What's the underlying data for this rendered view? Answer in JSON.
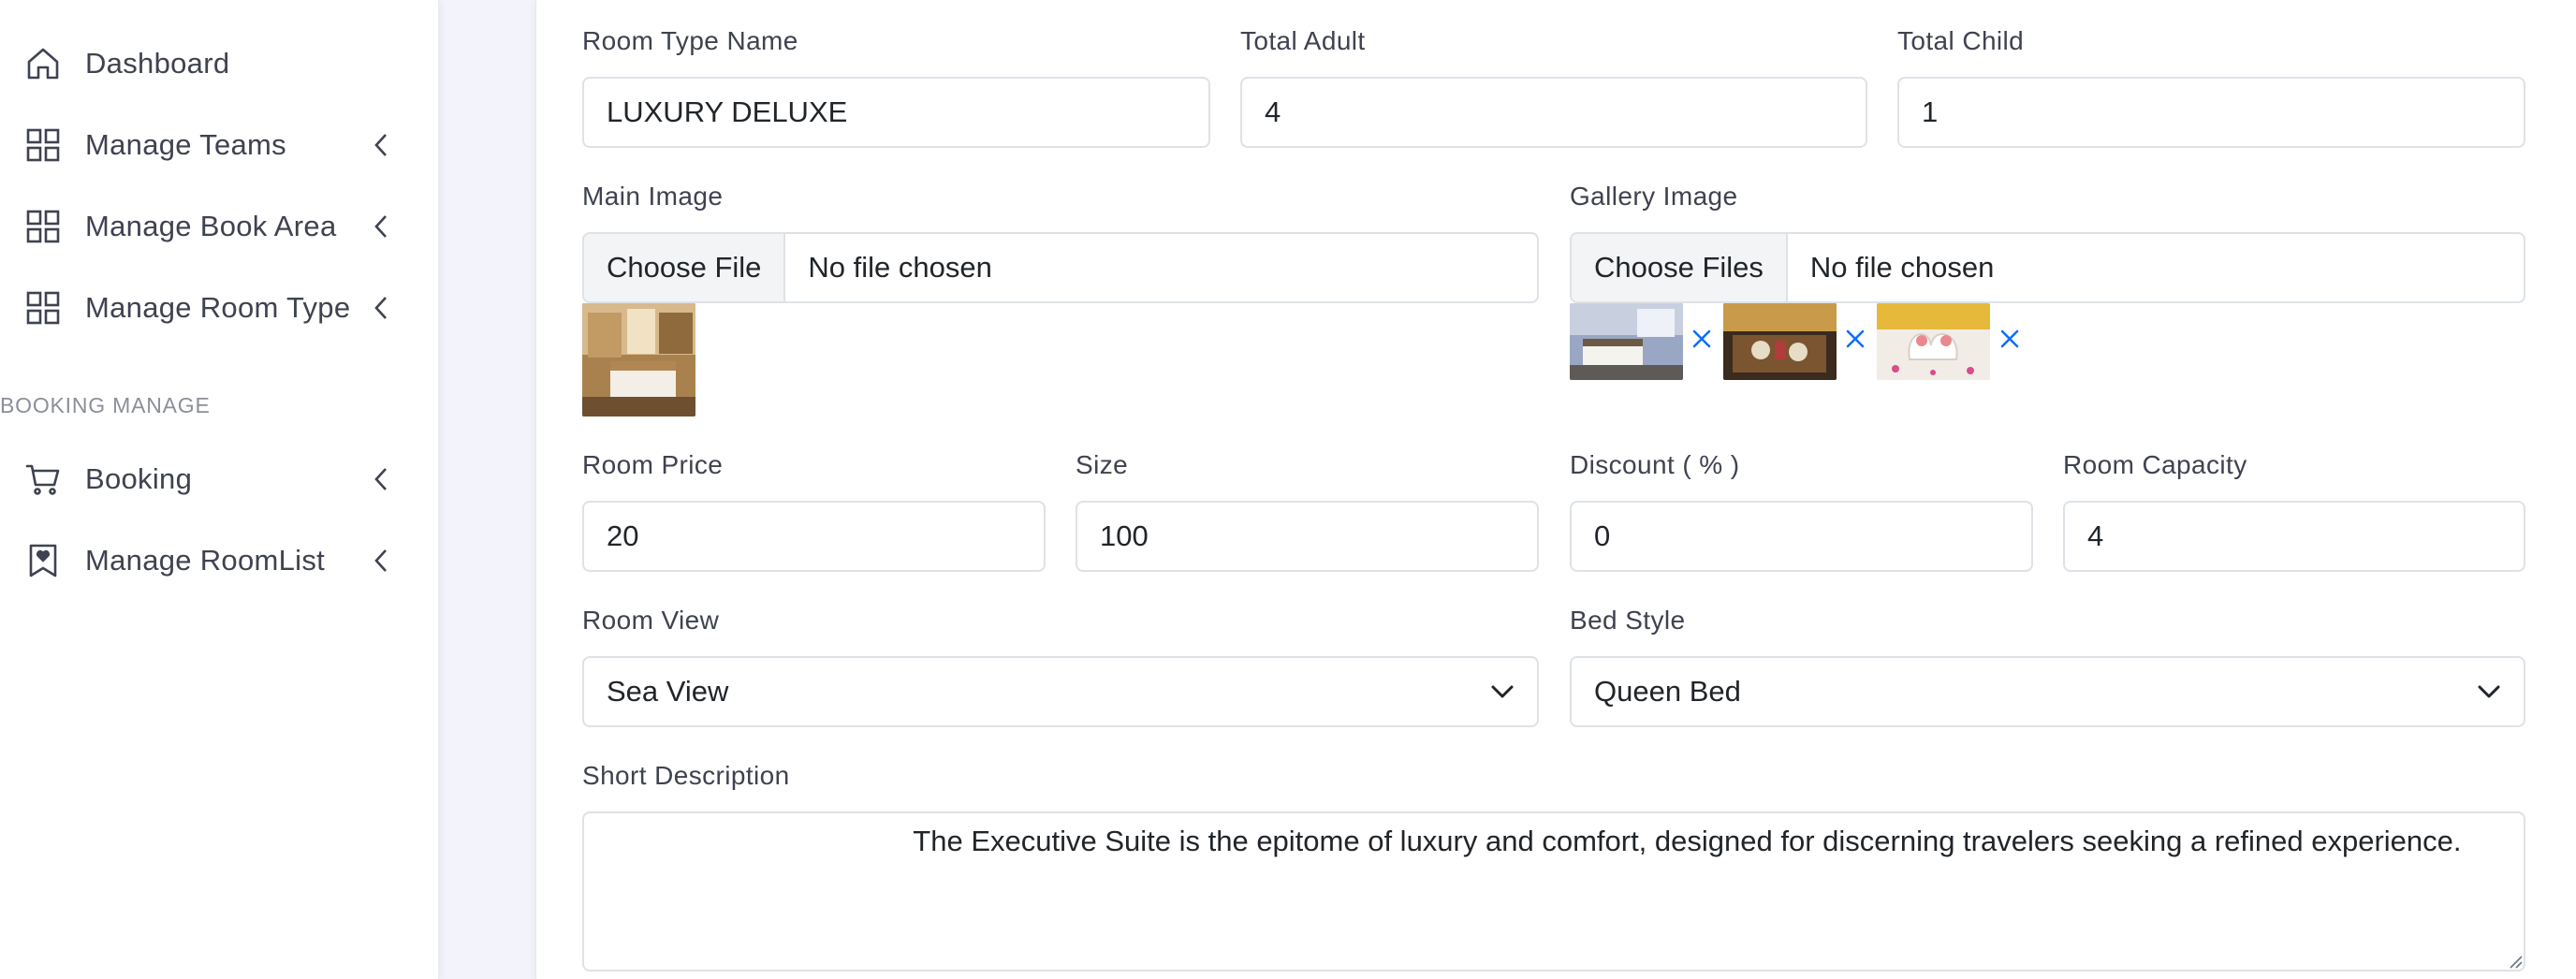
{
  "sidebar": {
    "items": [
      {
        "label": "Dashboard",
        "icon": "home-icon",
        "chevron": false
      },
      {
        "label": "Manage Teams",
        "icon": "grid-icon",
        "chevron": true
      },
      {
        "label": "Manage Book Area",
        "icon": "grid-icon",
        "chevron": true
      },
      {
        "label": "Manage Room Type",
        "icon": "grid-icon",
        "chevron": true
      },
      {
        "label": "Booking",
        "icon": "cart-icon",
        "chevron": true
      },
      {
        "label": "Manage RoomList",
        "icon": "bookmark-heart-icon",
        "chevron": true
      }
    ],
    "section_label": "BOOKING MANAGE"
  },
  "form": {
    "room_type_name": {
      "label": "Room Type Name",
      "value": "LUXURY DELUXE"
    },
    "total_adult": {
      "label": "Total Adult",
      "value": "4"
    },
    "total_child": {
      "label": "Total Child",
      "value": "1"
    },
    "main_image": {
      "label": "Main Image",
      "button": "Choose File",
      "status": "No file chosen"
    },
    "gallery_image": {
      "label": "Gallery Image",
      "button": "Choose Files",
      "status": "No file chosen"
    },
    "room_price": {
      "label": "Room Price",
      "value": "20"
    },
    "size": {
      "label": "Size",
      "value": "100"
    },
    "discount": {
      "label": "Discount ( % )",
      "value": "0"
    },
    "room_capacity": {
      "label": "Room Capacity",
      "value": "4"
    },
    "room_view": {
      "label": "Room View",
      "selected": "Sea View"
    },
    "bed_style": {
      "label": "Bed Style",
      "selected": "Queen Bed"
    },
    "short_description": {
      "label": "Short Description",
      "value": "                                      The Executive Suite is the epitome of luxury and comfort, designed for discerning travelers seeking a refined experience."
    }
  },
  "colors": {
    "accent": "#0d6efd",
    "text": "#212529",
    "muted": "#3f4250"
  }
}
